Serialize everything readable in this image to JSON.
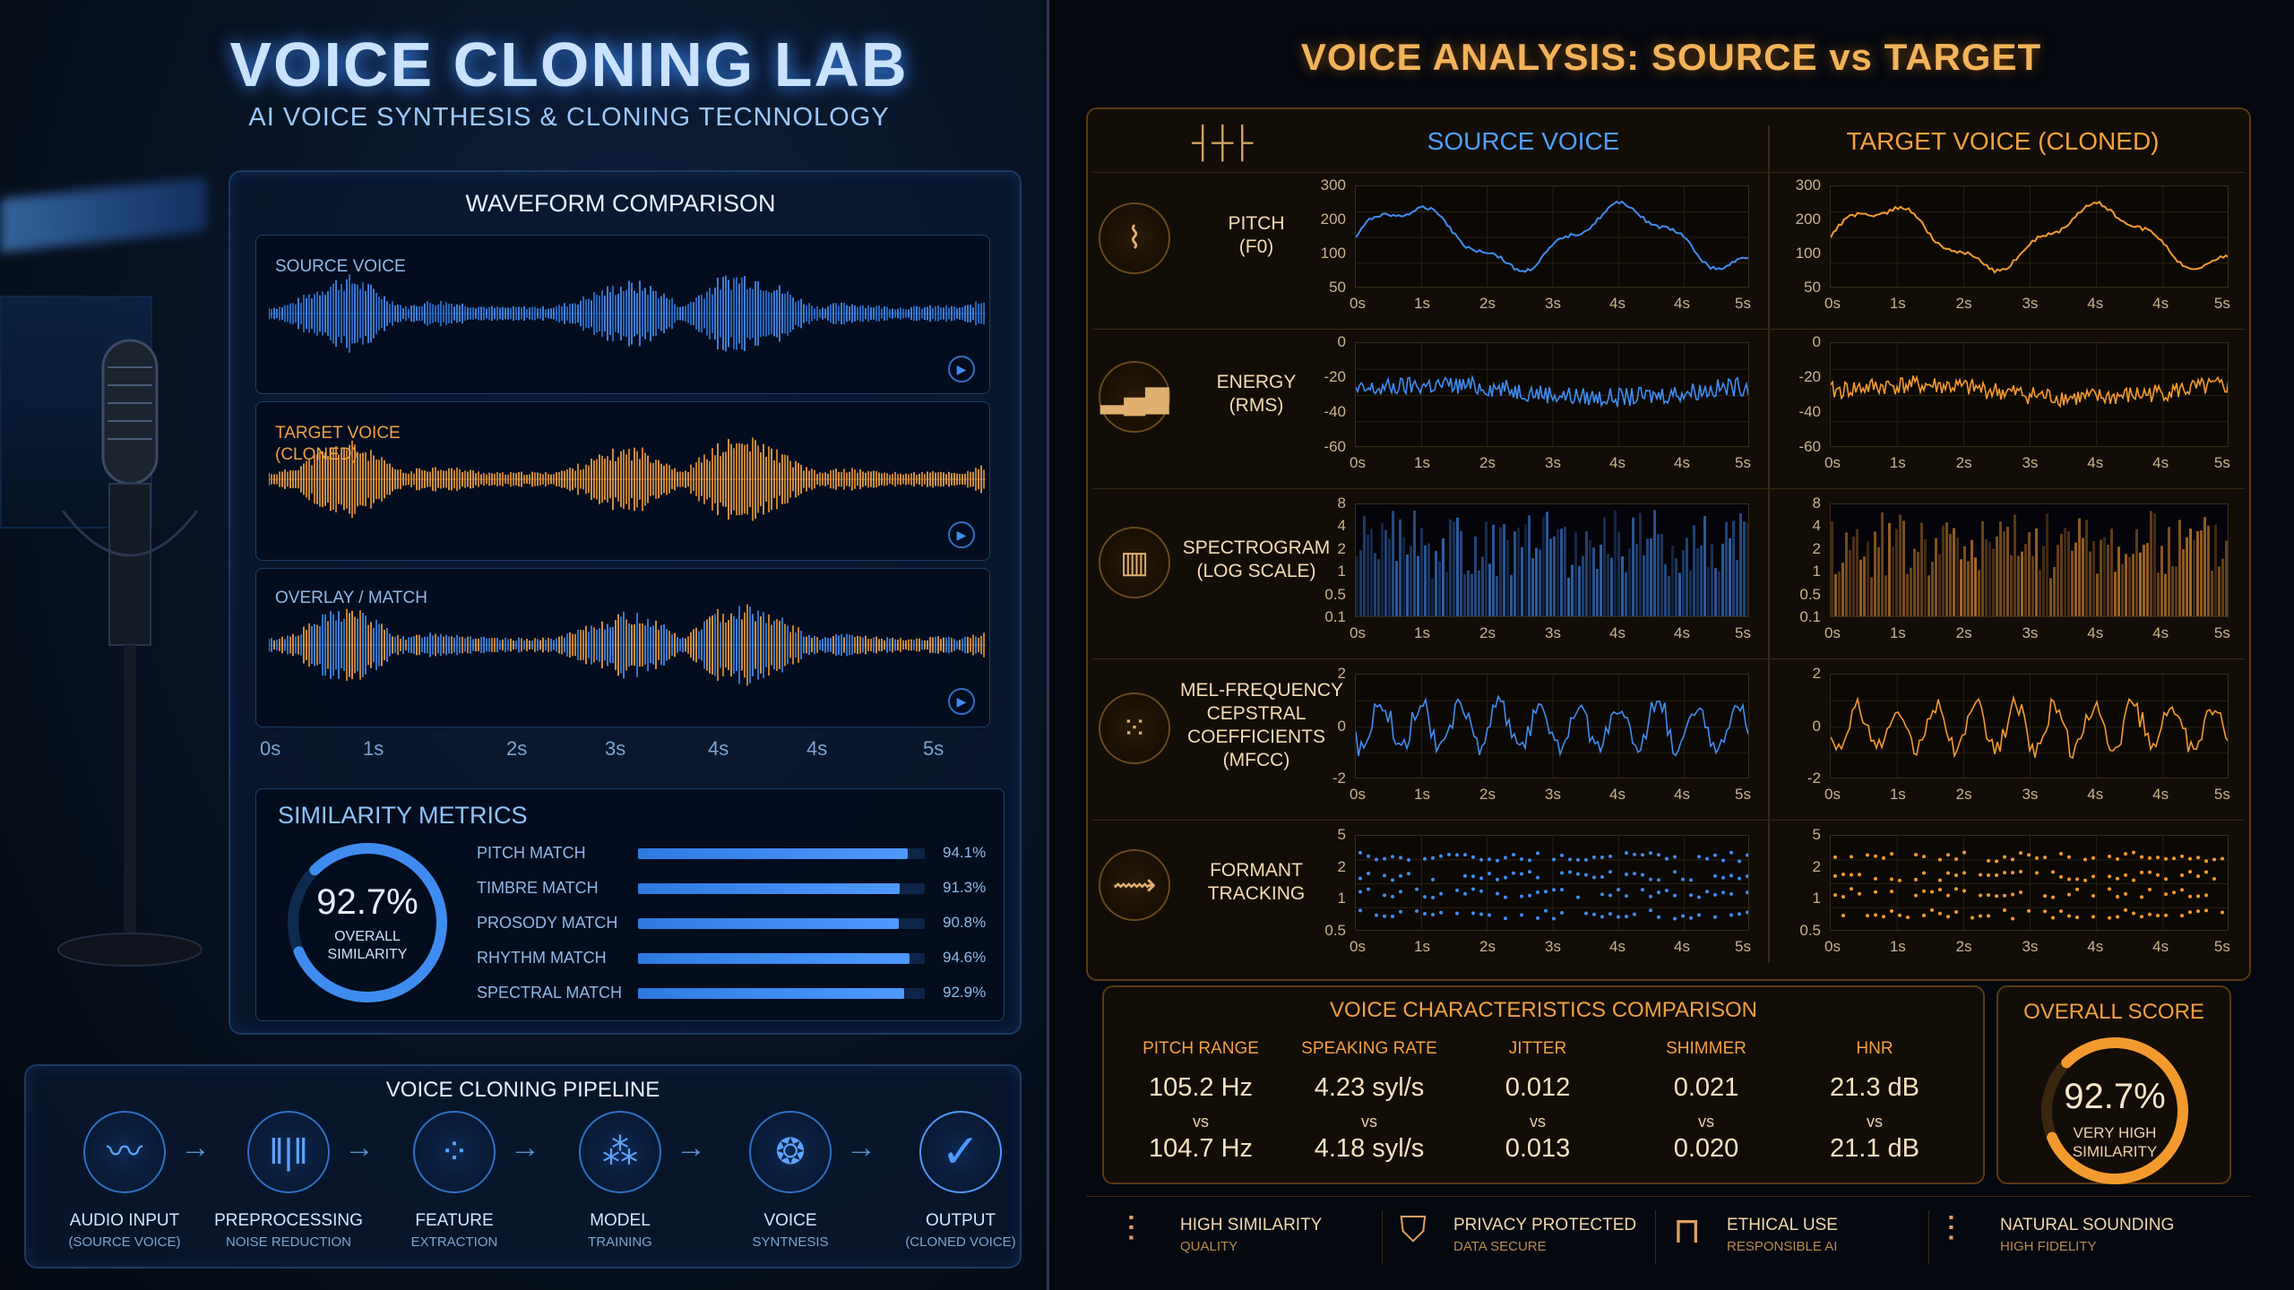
{
  "left": {
    "title": "VOICE CLONING LAB",
    "subtitle": "AI VOICE SYNTHESIS & CLONING TECNNOLOGY",
    "waveform": {
      "header": "WAVEFORM COMPARISON",
      "source_label": "SOURCE VOICE",
      "target_label": "TARGET VOICE\n(CLONED)",
      "overlay_label": "OVERLAY / MATCH",
      "axis": [
        "0s",
        "1s",
        "2s",
        "3s",
        "4s",
        "4s",
        "5s"
      ]
    },
    "metrics": {
      "header": "SIMILARITY METRICS",
      "overall_value": "92.7%",
      "overall_label": "OVERALL\nSIMILARITY",
      "overall_fraction": 0.927,
      "items": [
        {
          "name": "PITCH MATCH",
          "value": "94.1%",
          "fraction": 0.941
        },
        {
          "name": "TIMBRE MATCH",
          "value": "91.3%",
          "fraction": 0.913
        },
        {
          "name": "PROSODY MATCH",
          "value": "90.8%",
          "fraction": 0.908
        },
        {
          "name": "RHYTHM MATCH",
          "value": "94.6%",
          "fraction": 0.946
        },
        {
          "name": "SPECTRAL MATCH",
          "value": "92.9%",
          "fraction": 0.929
        }
      ]
    },
    "pipeline": {
      "header": "VOICE CLONING PIPELINE",
      "steps": [
        {
          "title": "AUDIO INPUT",
          "sub": "(SOURCE VOICE)",
          "icon": "waveform-icon"
        },
        {
          "title": "PREPROCESSING",
          "sub": "NOISE REDUCTION",
          "icon": "bars-icon"
        },
        {
          "title": "FEATURE",
          "sub": "EXTRACTION",
          "icon": "dots-grid-icon"
        },
        {
          "title": "MODEL",
          "sub": "TRAINING",
          "icon": "neural-icon"
        },
        {
          "title": "VOICE",
          "sub": "SYNTNESIS",
          "icon": "brain-icon"
        },
        {
          "title": "OUTPUT",
          "sub": "(CLONED VOICE)",
          "icon": "check-icon"
        }
      ]
    }
  },
  "right": {
    "title": "VOICE ANALYSIS: SOURCE vs TARGET",
    "source_header": "SOURCE VOICE",
    "target_header": "TARGET VOICE (CLONED)",
    "rows": [
      {
        "name": "PITCH\n(F0)",
        "yticks": [
          "300",
          "200",
          "100",
          "50"
        ],
        "icon": "pitch-icon"
      },
      {
        "name": "ENERGY\n(RMS)",
        "yticks": [
          "0",
          "-20",
          "-40",
          "-60"
        ],
        "icon": "energy-icon"
      },
      {
        "name": "SPECTROGRAM\n(LOG SCALE)",
        "yticks": [
          "8",
          "4",
          "2",
          "1",
          "0.5",
          "0.1"
        ],
        "icon": "spectrogram-icon"
      },
      {
        "name": "MEL-FREQUENCY\nCEPSTRAL\nCOEFFICIENTS\n(MFCC)",
        "yticks": [
          "2",
          "0",
          "-2"
        ],
        "icon": "mfcc-icon"
      },
      {
        "name": "FORMANT\nTRACKING",
        "yticks": [
          "5",
          "2",
          "1",
          "0.5"
        ],
        "icon": "formant-icon"
      }
    ],
    "xticks": [
      "0s",
      "1s",
      "2s",
      "3s",
      "4s",
      "4s",
      "5s"
    ],
    "comparison": {
      "header": "VOICE CHARACTERISTICS COMPARISON",
      "vs": "vs",
      "items": [
        {
          "name": "PITCH RANGE",
          "source": "105.2 Hz",
          "target": "104.7 Hz"
        },
        {
          "name": "SPEAKING RATE",
          "source": "4.23 syl/s",
          "target": "4.18 syl/s"
        },
        {
          "name": "JITTER",
          "source": "0.012",
          "target": "0.013"
        },
        {
          "name": "SHIMMER",
          "source": "0.021",
          "target": "0.020"
        },
        {
          "name": "HNR",
          "source": "21.3 dB",
          "target": "21.1 dB"
        }
      ]
    },
    "overall": {
      "header": "OVERALL SCORE",
      "value": "92.7%",
      "label": "VERY HIGH\nSIMILARITY",
      "fraction": 0.927
    },
    "footer": [
      {
        "title": "HIGH SIMILARITY",
        "sub": "QUALITY",
        "icon": "waveform-icon"
      },
      {
        "title": "PRIVACY PROTECTED",
        "sub": "DATA SECURE",
        "icon": "shield-icon"
      },
      {
        "title": "ETHICAL USE",
        "sub": "RESPONSIBLE AI",
        "icon": "lock-icon"
      },
      {
        "title": "NATURAL SOUNDING",
        "sub": "HIGH FIDELITY",
        "icon": "waveform-icon"
      }
    ]
  },
  "colors": {
    "blue": "#3f8cf0",
    "orange": "#f39a2e"
  }
}
